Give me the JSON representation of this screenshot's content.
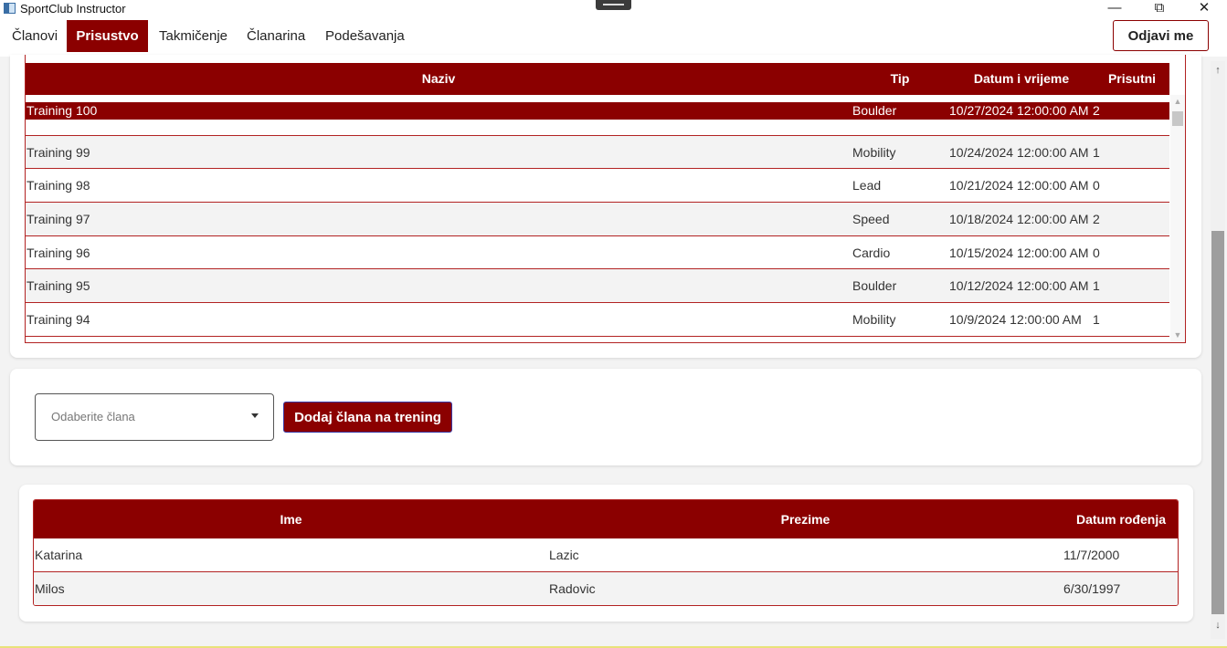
{
  "window": {
    "title": "SportClub Instructor",
    "controls": {
      "minimize": "—",
      "restore": "⧉",
      "close": "✕"
    }
  },
  "nav": {
    "items": [
      "Članovi",
      "Prisustvo",
      "Takmičenje",
      "Članarina",
      "Podešavanja"
    ],
    "active": "Prisustvo",
    "logout_label": "Odjavi me"
  },
  "trainings": {
    "columns": [
      "Naziv",
      "Tip",
      "Datum i vrijeme",
      "Prisutni"
    ],
    "rows": [
      {
        "name": "Training 100",
        "type": "Boulder",
        "datetime": "10/27/2024 12:00:00 AM",
        "present": "2",
        "selected": true
      },
      {
        "name": "Training 99",
        "type": "Mobility",
        "datetime": "10/24/2024 12:00:00 AM",
        "present": "1"
      },
      {
        "name": "Training 98",
        "type": "Lead",
        "datetime": "10/21/2024 12:00:00 AM",
        "present": "0"
      },
      {
        "name": "Training 97",
        "type": "Speed",
        "datetime": "10/18/2024 12:00:00 AM",
        "present": "2"
      },
      {
        "name": "Training 96",
        "type": "Cardio",
        "datetime": "10/15/2024 12:00:00 AM",
        "present": "0"
      },
      {
        "name": "Training 95",
        "type": "Boulder",
        "datetime": "10/12/2024 12:00:00 AM",
        "present": "1"
      },
      {
        "name": "Training 94",
        "type": "Mobility",
        "datetime": "10/9/2024 12:00:00 AM",
        "present": "1"
      }
    ]
  },
  "add_member": {
    "placeholder": "Odaberite člana",
    "button_label": "Dodaj člana na trening"
  },
  "members": {
    "columns": [
      "Ime",
      "Prezime",
      "Datum rođenja"
    ],
    "rows": [
      {
        "first": "Katarina",
        "last": "Lazic",
        "dob": "11/7/2000"
      },
      {
        "first": "Milos",
        "last": "Radovic",
        "dob": "6/30/1997"
      }
    ]
  },
  "colors": {
    "accent": "#8b0000",
    "border": "#b22222"
  }
}
